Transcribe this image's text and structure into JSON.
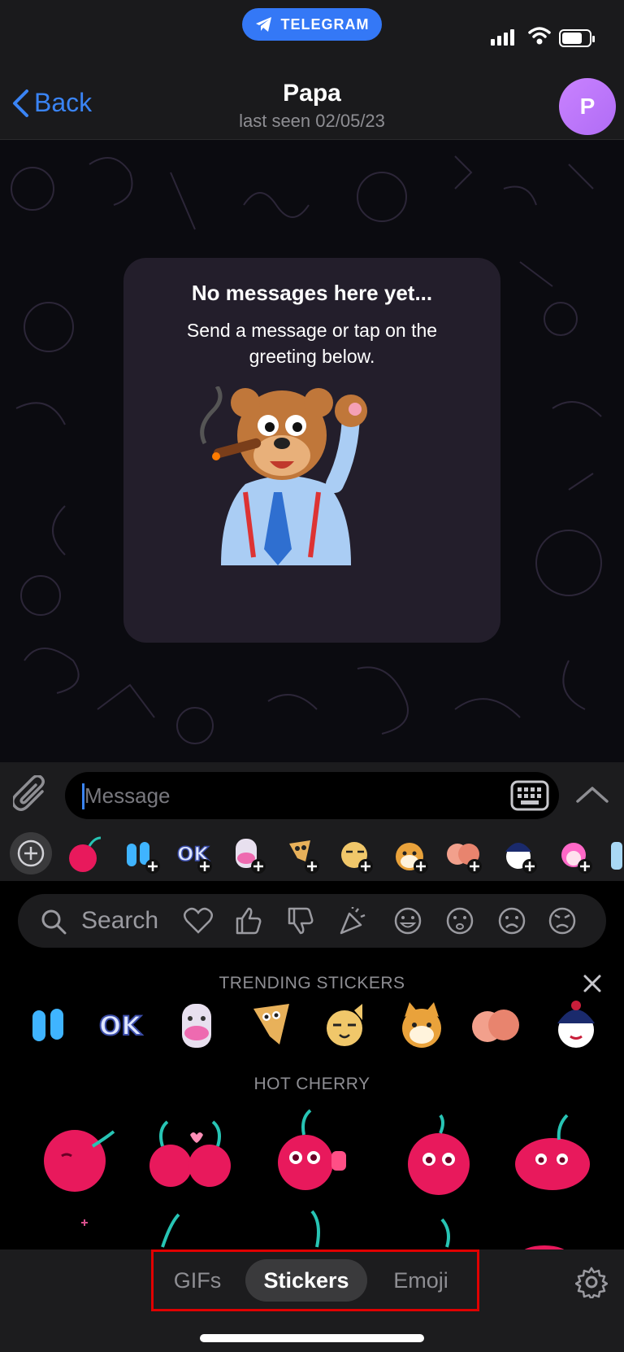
{
  "status": {
    "app_pill_label": "TELEGRAM",
    "battery_level": 0.75
  },
  "header": {
    "back_label": "Back",
    "title": "Papa",
    "subtitle": "last seen 02/05/23",
    "avatar_initial": "P",
    "avatar_color": "#b06cf5"
  },
  "chat": {
    "empty_title": "No messages here yet...",
    "empty_body": "Send a message or tap on the greeting below.",
    "greeting_sticker": "bear-with-cigar-waving-sticker"
  },
  "composer": {
    "placeholder": "Message",
    "attach_icon": "paperclip-icon",
    "keyboard_icon": "keyboard-icon",
    "expand_icon": "chevron-up-icon",
    "sticker_strip": [
      "hot-cherry-sticker",
      "blue-capsule-sticker",
      "ok-sticker",
      "pink-nose-creature-sticker",
      "dog-face-sticker",
      "smirking-cat-sticker",
      "shiba-dog-sticker",
      "peach-sticker",
      "geisha-sticker",
      "pink-hair-girl-sticker",
      "blue-bottle-sticker"
    ]
  },
  "panel": {
    "search_label": "Search",
    "search_emojis": [
      "heart-icon",
      "thumbs-up-icon",
      "thumbs-down-icon",
      "party-popper-icon",
      "grinning-face-icon",
      "worried-face-icon",
      "frowning-face-icon",
      "angry-face-icon"
    ],
    "trending_title": "TRENDING STICKERS",
    "trending": [
      "blue-capsule-sticker",
      "ok-sticker",
      "pink-nose-creature-sticker",
      "dog-face-sticker",
      "smirking-cat-sticker",
      "shiba-dog-sticker",
      "peach-sticker",
      "geisha-sticker"
    ],
    "pack_title": "HOT CHERRY",
    "pack_items": [
      "cherry-sleeping",
      "cherry-kiss",
      "cherry-thumbs-up",
      "cherry-thinking",
      "cherry-happy"
    ]
  },
  "tabs": {
    "items": [
      {
        "label": "GIFs",
        "active": false
      },
      {
        "label": "Stickers",
        "active": true
      },
      {
        "label": "Emoji",
        "active": false
      }
    ],
    "settings_icon": "gear-icon"
  },
  "colors": {
    "accent": "#3a84f5",
    "highlight_box": "#e00000"
  }
}
